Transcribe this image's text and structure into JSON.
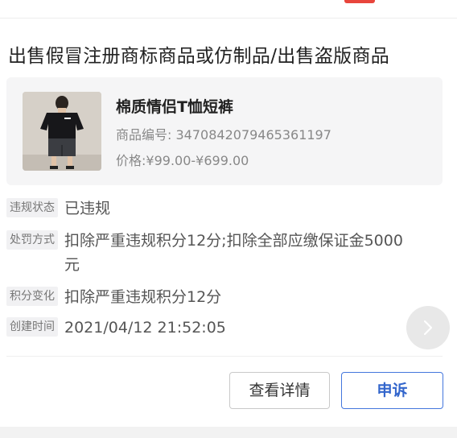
{
  "violation": {
    "title": "出售假冒注册商标商品或仿制品/出售盗版商品"
  },
  "product": {
    "name": "棉质情侣T恤短裤",
    "code_label": "商品编号:",
    "code": "3470842079465361197",
    "price_label": "价格:",
    "price": "¥99.00-¥699.00"
  },
  "info": {
    "status_label": "违规状态",
    "status_value": "已违规",
    "penalty_label": "处罚方式",
    "penalty_value": "扣除严重违规积分12分;扣除全部应缴保证金5000元",
    "points_label": "积分变化",
    "points_value": "扣除严重违规积分12分",
    "created_label": "创建时间",
    "created_value": "2021/04/12 21:52:05"
  },
  "actions": {
    "detail_label": "查看详情",
    "appeal_label": "申诉"
  },
  "colors": {
    "accent": "#3366cc",
    "badge_red": "#e8453c"
  },
  "icons": {
    "scroll": "chevron-right-icon",
    "product": "product-thumbnail"
  }
}
